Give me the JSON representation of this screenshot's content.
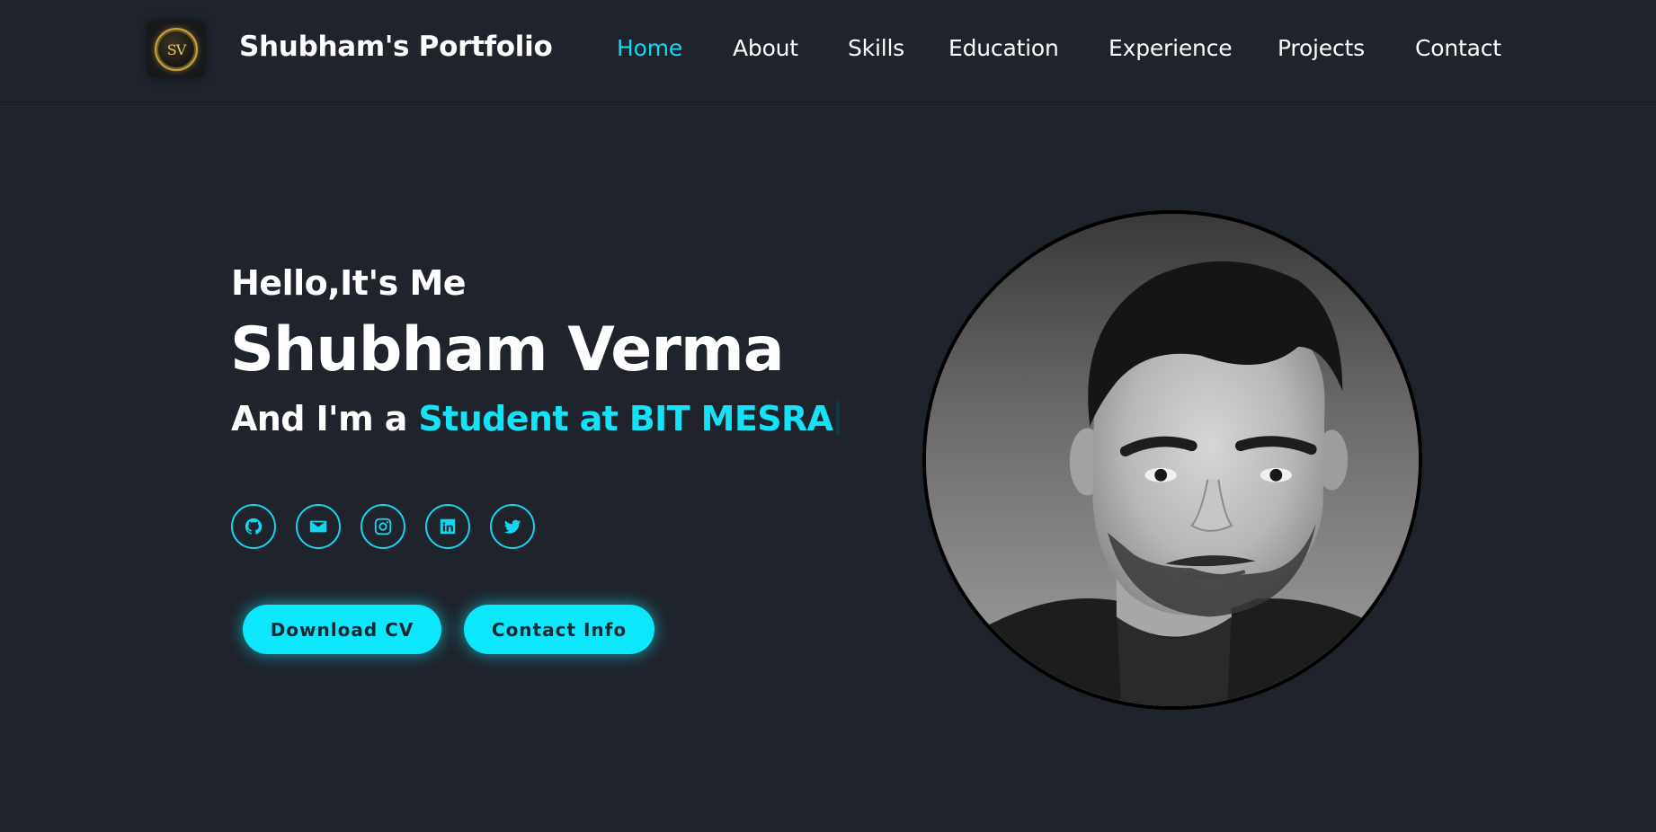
{
  "header": {
    "logo_text": "SV",
    "brand": "Shubham's Portfolio",
    "nav": [
      {
        "label": "Home",
        "active": true
      },
      {
        "label": "About",
        "active": false
      },
      {
        "label": "Skills",
        "active": false
      },
      {
        "label": "Education",
        "active": false
      },
      {
        "label": "Experience",
        "active": false
      },
      {
        "label": "Projects",
        "active": false
      },
      {
        "label": "Contact",
        "active": false
      }
    ]
  },
  "hero": {
    "greeting": "Hello,It's Me",
    "name": "Shubham Verma",
    "role_prefix": "And I'm a ",
    "role_highlight": "Student at BIT MESRA",
    "social": [
      {
        "icon": "github-icon"
      },
      {
        "icon": "mail-icon"
      },
      {
        "icon": "instagram-icon"
      },
      {
        "icon": "linkedin-icon"
      },
      {
        "icon": "twitter-icon"
      }
    ],
    "buttons": {
      "download_cv": "Download CV",
      "contact_info": "Contact Info"
    }
  },
  "colors": {
    "background": "#1f232c",
    "accent": "#16d6ee",
    "button_bg": "#0ce7fb",
    "button_text": "#1b2530",
    "text": "#ffffff"
  }
}
